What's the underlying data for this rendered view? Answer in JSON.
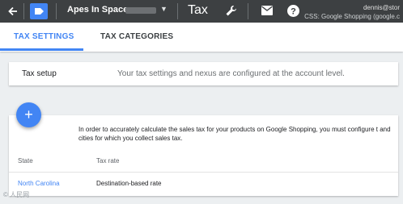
{
  "topbar": {
    "account_name": "Apes In Space",
    "page_title": "Tax",
    "user_email": "dennis@stor",
    "user_sub": "CSS: Google Shopping (google.c",
    "icons": [
      "back-arrow-icon",
      "merchant-center-logo-icon",
      "chevron-down-icon",
      "wrench-icon",
      "mail-icon",
      "help-icon"
    ]
  },
  "tabs": [
    {
      "label": "TAX SETTINGS",
      "active": true
    },
    {
      "label": "TAX CATEGORIES",
      "active": false
    }
  ],
  "tax_setup": {
    "label": "Tax setup",
    "description": "Your tax settings and nexus are configured at the account level."
  },
  "nexus": {
    "intro": "In order to accurately calculate the sales tax for your products on Google Shopping, you must configure t and cities for which you collect sales tax.",
    "columns": [
      "State",
      "Tax rate"
    ],
    "rows": [
      {
        "state": "North Carolina",
        "rate": "Destination-based rate"
      }
    ]
  },
  "fab": {
    "label": "+"
  },
  "watermark": "© 人民网",
  "colors": {
    "accent": "#4285f4",
    "topbar": "#3d4042"
  }
}
